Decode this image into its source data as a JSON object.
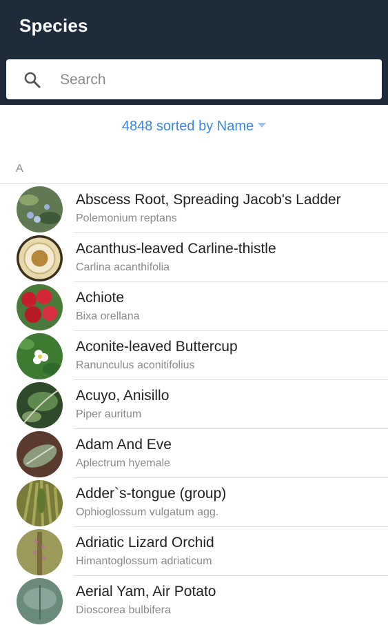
{
  "appbar": {
    "title": "Species"
  },
  "search": {
    "placeholder": "Search",
    "icon": "search-icon"
  },
  "sort": {
    "label": "4848 sorted by Name"
  },
  "section_letter": "A",
  "species": [
    {
      "name": "Abscess Root, Spreading Jacob's Ladder",
      "scientific": "Polemonium reptans"
    },
    {
      "name": "Acanthus-leaved Carline-thistle",
      "scientific": "Carlina acanthifolia"
    },
    {
      "name": "Achiote",
      "scientific": "Bixa orellana"
    },
    {
      "name": "Aconite-leaved Buttercup",
      "scientific": "Ranunculus aconitifolius"
    },
    {
      "name": "Acuyo, Anisillo",
      "scientific": "Piper auritum"
    },
    {
      "name": "Adam And Eve",
      "scientific": "Aplectrum hyemale"
    },
    {
      "name": "Adder`s-tongue (group)",
      "scientific": "Ophioglossum vulgatum agg."
    },
    {
      "name": "Adriatic Lizard Orchid",
      "scientific": "Himantoglossum adriaticum"
    },
    {
      "name": "Aerial Yam, Air Potato",
      "scientific": "Dioscorea bulbifera"
    }
  ],
  "colors": {
    "appbar": "#1d2b3a",
    "accent": "#3a86e0"
  }
}
